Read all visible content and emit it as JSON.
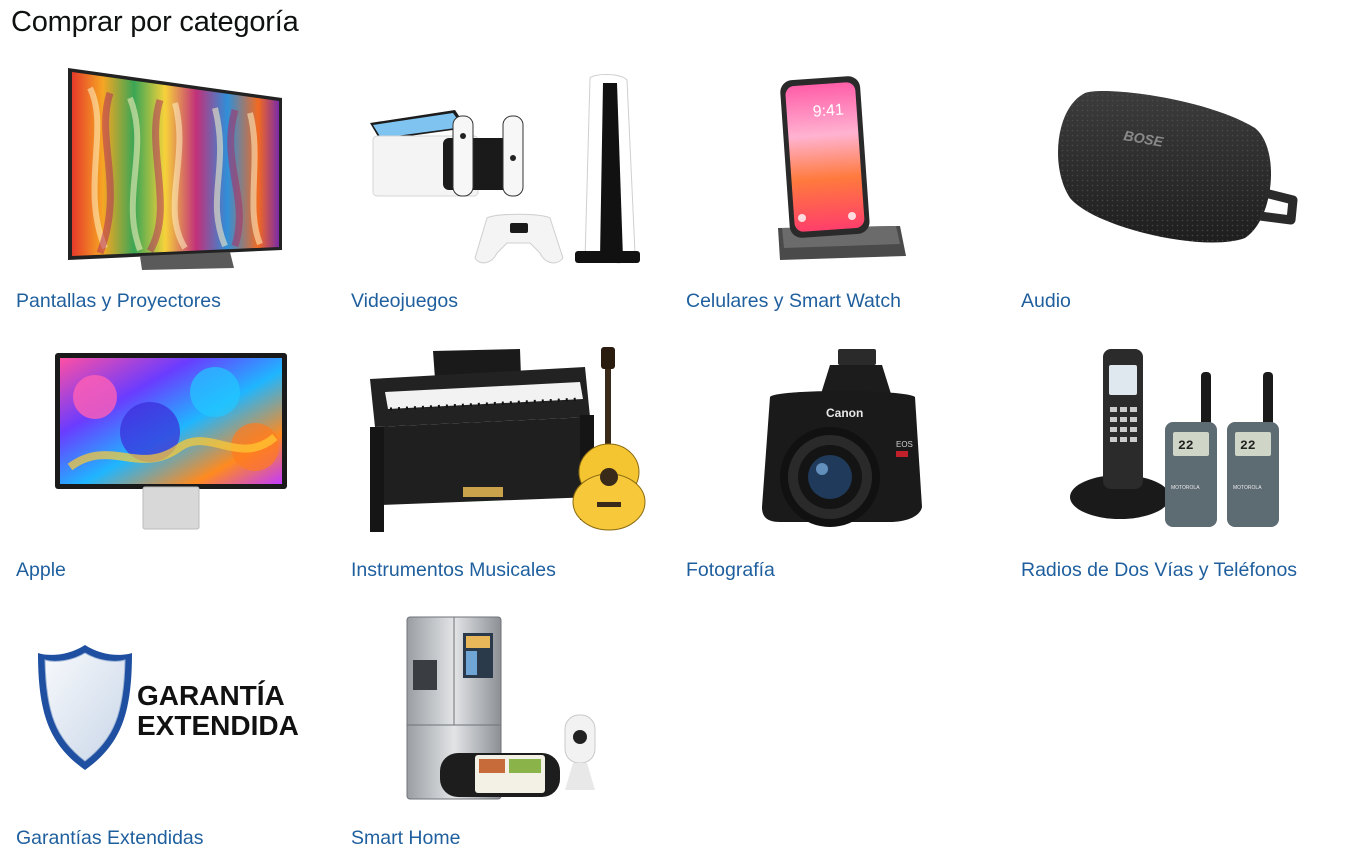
{
  "section": {
    "title": "Comprar por categoría"
  },
  "categories": [
    {
      "label": "Pantallas y Proyectores",
      "icon": "tv-icon"
    },
    {
      "label": "Videojuegos",
      "icon": "game-console-icon"
    },
    {
      "label": "Celulares y Smart Watch",
      "icon": "smartphone-icon"
    },
    {
      "label": "Audio",
      "icon": "speaker-icon"
    },
    {
      "label": "Apple",
      "icon": "monitor-icon"
    },
    {
      "label": "Instrumentos Musicales",
      "icon": "piano-guitar-icon"
    },
    {
      "label": "Fotografía",
      "icon": "camera-icon"
    },
    {
      "label": "Radios de Dos Vías y Teléfonos",
      "icon": "radio-phone-icon"
    },
    {
      "label": "Garantías Extendidas",
      "icon": "shield-icon"
    },
    {
      "label": "Smart Home",
      "icon": "smart-fridge-icon"
    }
  ],
  "product_marks": {
    "speaker_brand": "BOSE",
    "phone_time": "9:41",
    "camera_brand": "Canon",
    "camera_model": "EOS",
    "radio_brand": "MOTOROLA",
    "radio_display": "22",
    "warranty_line1": "GARANTÍA",
    "warranty_line2": "EXTENDIDA"
  }
}
